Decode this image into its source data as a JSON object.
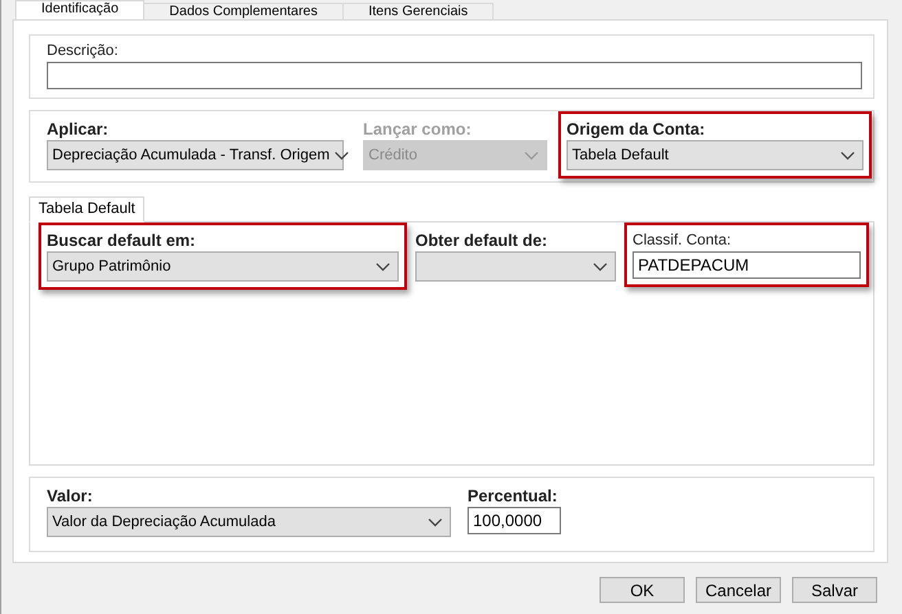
{
  "top_tabs": [
    {
      "label": "Identificação",
      "selected": true
    },
    {
      "label": "Dados Complementares",
      "selected": false
    },
    {
      "label": "Itens Gerenciais",
      "selected": false
    }
  ],
  "description": {
    "label": "Descrição:"
  },
  "account_section": {
    "fields": [
      {
        "kind": "dropdown",
        "label": "Aplicar:",
        "value": "Depreciação Acumulada - Transf. Origem",
        "disabled": false,
        "highlighted": false
      },
      {
        "kind": "dropdown",
        "label": "Lançar como:",
        "value": "Crédito",
        "disabled": true,
        "highlighted": false
      },
      {
        "kind": "dropdown",
        "label": "Origem da Conta:",
        "value": "Tabela Default",
        "disabled": false,
        "highlighted": true
      }
    ]
  },
  "inner_tabs": [
    {
      "label": "Tabela Default",
      "selected": true
    }
  ],
  "default_section": {
    "fields": [
      {
        "kind": "dropdown",
        "label": "Buscar default em:",
        "value": "Grupo Patrimônio",
        "disabled": false,
        "highlighted": true
      },
      {
        "kind": "dropdown",
        "label": "Obter default de:",
        "disabled": false,
        "highlighted": false
      },
      {
        "kind": "caption-input",
        "label": "Classif. Conta:",
        "value": "PATDEPACUM",
        "disabled": false,
        "highlighted": true
      }
    ]
  },
  "value_section": {
    "fields": [
      {
        "kind": "dropdown",
        "label": "Valor:",
        "value": "Valor da Depreciação Acumulada",
        "disabled": false,
        "highlighted": false
      },
      {
        "kind": "input",
        "label": "Percentual:",
        "value": "100,0000",
        "disabled": false,
        "highlighted": false
      }
    ]
  },
  "buttons": [
    "OK",
    "Cancelar",
    "Salvar"
  ]
}
